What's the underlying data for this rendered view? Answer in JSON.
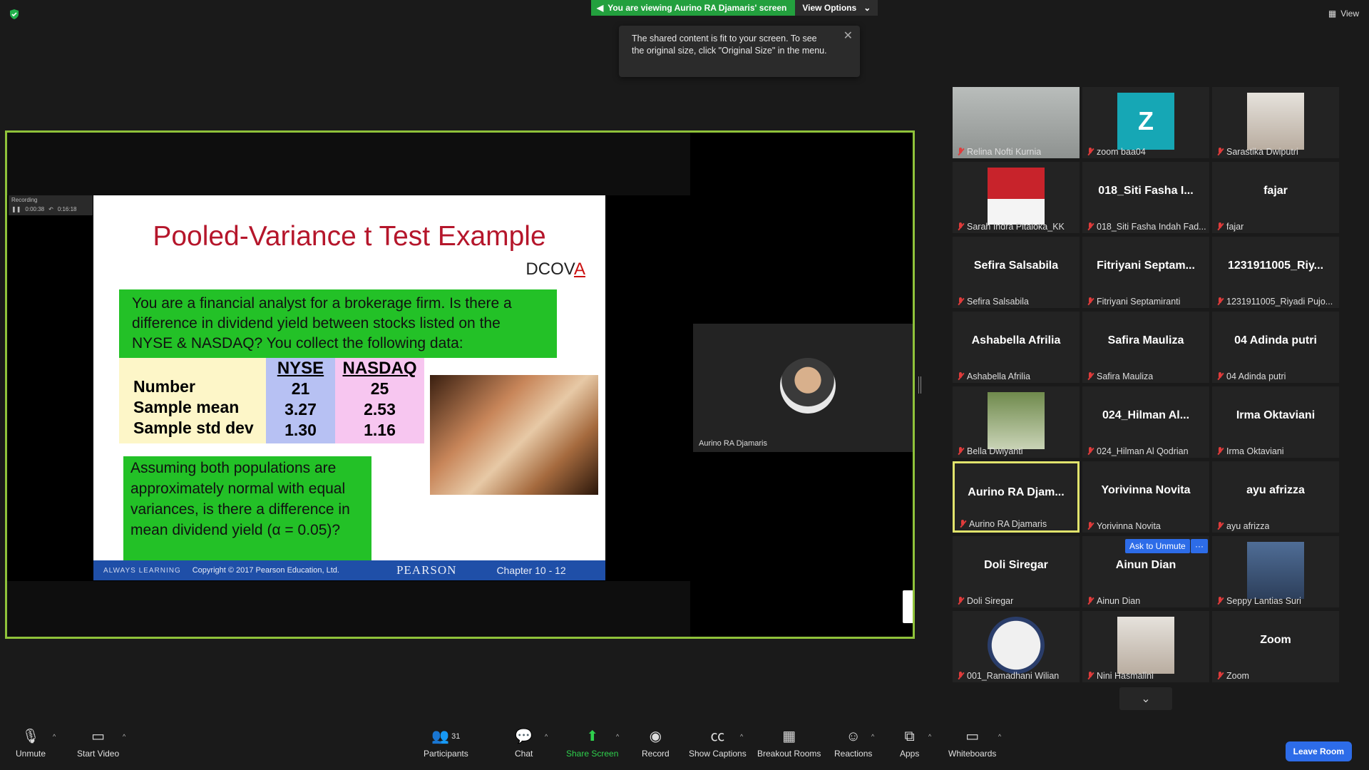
{
  "banner": {
    "viewing_text": "You are viewing Aurino RA Djamaris' screen",
    "view_options_label": "View Options"
  },
  "top_right": {
    "view_label": "View"
  },
  "tooltip": {
    "text": "The shared content is fit to your screen. To see the original size, click \"Original Size\" in the menu."
  },
  "slide": {
    "title": "Pooled-Variance t Test Example",
    "brand": "DCOV",
    "brand_last": "A",
    "question": "You are a financial analyst for a brokerage firm.  Is there a difference in dividend yield between stocks listed on the NYSE & NASDAQ?  You collect the following data:",
    "row_labels": [
      "Number",
      "Sample mean",
      "Sample std dev"
    ],
    "nyse_header": "NYSE",
    "nyse_values": [
      "21",
      "3.27",
      "1.30"
    ],
    "nasdaq_header": "NASDAQ",
    "nasdaq_values": [
      "25",
      "2.53",
      "1.16"
    ],
    "assumption": "Assuming both populations are approximately normal with equal variances, is there a difference in mean dividend yield (α = 0.05)?",
    "footer_always": "ALWAYS LEARNING",
    "footer_copyright": "Copyright © 2017 Pearson Education, Ltd.",
    "footer_pearson": "PEARSON",
    "footer_chapter": "Chapter 10 - 12"
  },
  "recording_bar": {
    "label": "Recording",
    "elapsed": "0:00:38",
    "total": "0:16:18"
  },
  "presenter": {
    "name": "Aurino RA Djamaris"
  },
  "gallery": {
    "tiles": [
      {
        "big": "",
        "label": "Relina Nofti Kurnia",
        "kind": "video-gray"
      },
      {
        "big": "Z",
        "label": "zoom baa04",
        "kind": "letter"
      },
      {
        "big": "",
        "label": "Sarastika Dwiputri",
        "kind": "photo"
      },
      {
        "big": "",
        "label": "Sarah Indra Pitaloka_KK",
        "kind": "photo-red"
      },
      {
        "big": "018_Siti Fasha I...",
        "label": "018_Siti Fasha Indah Fad...",
        "kind": "name"
      },
      {
        "big": "fajar",
        "label": "fajar",
        "kind": "name"
      },
      {
        "big": "Sefira Salsabila",
        "label": "Sefira Salsabila",
        "kind": "name"
      },
      {
        "big": "Fitriyani  Septam...",
        "label": "Fitriyani Septamiranti",
        "kind": "name"
      },
      {
        "big": "1231911005_Riy...",
        "label": "1231911005_Riyadi Pujo...",
        "kind": "name"
      },
      {
        "big": "Ashabella Afrilia",
        "label": "Ashabella Afrilia",
        "kind": "name"
      },
      {
        "big": "Safira Mauliza",
        "label": "Safira Mauliza",
        "kind": "name"
      },
      {
        "big": "04 Adinda putri",
        "label": "04 Adinda putri",
        "kind": "name"
      },
      {
        "big": "",
        "label": "Bella Dwiyanti",
        "kind": "photo-green"
      },
      {
        "big": "024_Hilman  Al...",
        "label": "024_Hilman Al Qodrian",
        "kind": "name"
      },
      {
        "big": "Irma Oktaviani",
        "label": "Irma Oktaviani",
        "kind": "name"
      },
      {
        "big": "Aurino  RA  Djam...",
        "label": "Aurino RA Djamaris",
        "kind": "name-active"
      },
      {
        "big": "Yorivinna Novita",
        "label": "Yorivinna Novita",
        "kind": "name"
      },
      {
        "big": "ayu afrizza",
        "label": "ayu afrizza",
        "kind": "name"
      },
      {
        "big": "Doli Siregar",
        "label": "Doli Siregar",
        "kind": "name"
      },
      {
        "big": "Ainun Dian",
        "label": "Ainun Dian",
        "kind": "name"
      },
      {
        "big": "",
        "label": "Seppy Lantias Suri",
        "kind": "photo-blue"
      },
      {
        "big": "",
        "label": "001_Ramadhani Wilian",
        "kind": "photo-round"
      },
      {
        "big": "",
        "label": "Nini Hasmalini",
        "kind": "photo"
      },
      {
        "big": "Zoom",
        "label": "Zoom",
        "kind": "name"
      }
    ],
    "ask_unmute_label": "Ask to Unmute",
    "more_label": "···"
  },
  "toolbar": {
    "unmute": "Unmute",
    "start_video": "Start Video",
    "participants": "Participants",
    "participants_count": "31",
    "chat": "Chat",
    "share_screen": "Share Screen",
    "record": "Record",
    "show_captions": "Show Captions",
    "breakout_rooms": "Breakout Rooms",
    "reactions": "Reactions",
    "apps": "Apps",
    "whiteboards": "Whiteboards",
    "leave_room": "Leave Room"
  },
  "colors": {
    "accent_green": "#8fc23a",
    "share_green": "#23a03e",
    "leave_blue": "#2d6ce8"
  }
}
